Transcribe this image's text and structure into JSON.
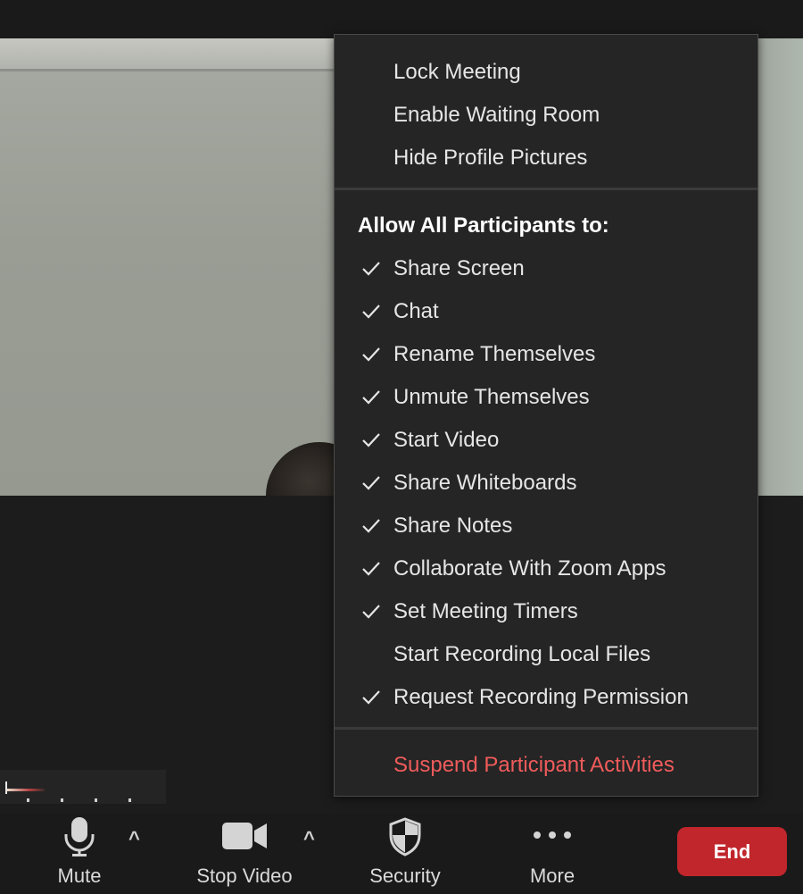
{
  "security_menu": {
    "top_items": [
      {
        "label": "Lock Meeting"
      },
      {
        "label": "Enable Waiting Room"
      },
      {
        "label": "Hide Profile Pictures"
      }
    ],
    "section_header": "Allow All Participants to:",
    "permissions": [
      {
        "label": "Share Screen",
        "checked": true
      },
      {
        "label": "Chat",
        "checked": true
      },
      {
        "label": "Rename Themselves",
        "checked": true
      },
      {
        "label": "Unmute Themselves",
        "checked": true
      },
      {
        "label": "Start Video",
        "checked": true
      },
      {
        "label": "Share Whiteboards",
        "checked": true
      },
      {
        "label": "Share Notes",
        "checked": true
      },
      {
        "label": "Collaborate With Zoom Apps",
        "checked": true
      },
      {
        "label": "Set Meeting Timers",
        "checked": true
      },
      {
        "label": "Start Recording Local Files",
        "checked": false
      },
      {
        "label": "Request Recording Permission",
        "checked": true
      }
    ],
    "suspend_label": "Suspend Participant Activities"
  },
  "toolbar": {
    "mute_label": "Mute",
    "stop_video_label": "Stop Video",
    "security_label": "Security",
    "more_label": "More",
    "end_label": "End",
    "caret_glyph": "^"
  },
  "colors": {
    "menu_bg": "#252525",
    "danger_text": "#f05b5b",
    "end_button": "#c0262b",
    "toolbar_bg": "#1a1a1a"
  }
}
